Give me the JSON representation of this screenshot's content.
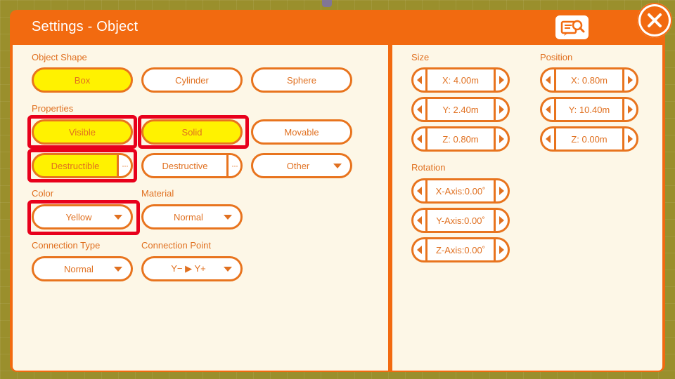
{
  "title": "Settings - Object",
  "help_icon": "document-search-icon",
  "close_icon": "close-icon",
  "object_shape": {
    "label": "Object Shape",
    "options": [
      "Box",
      "Cylinder",
      "Sphere"
    ],
    "selected": "Box"
  },
  "properties": {
    "label": "Properties",
    "visible": "Visible",
    "solid": "Solid",
    "movable": "Movable",
    "destructible": "Destructible",
    "destructive": "Destructive",
    "other": "Other",
    "more": "···"
  },
  "color": {
    "label": "Color",
    "value": "Yellow"
  },
  "material": {
    "label": "Material",
    "value": "Normal"
  },
  "connection_type": {
    "label": "Connection Type",
    "value": "Normal"
  },
  "connection_point": {
    "label": "Connection Point",
    "value": "Y− ▶ Y+"
  },
  "size": {
    "label": "Size",
    "x": "X: 4.00m",
    "y": "Y: 2.40m",
    "z": "Z: 0.80m"
  },
  "position": {
    "label": "Position",
    "x": "X: 0.80m",
    "y": "Y: 10.40m",
    "z": "Z: 0.00m"
  },
  "rotation": {
    "label": "Rotation",
    "x": "X-Axis:0.00˚",
    "y": "Y-Axis:0.00˚",
    "z": "Z-Axis:0.00˚"
  },
  "colors": {
    "accent": "#f26a10",
    "selected": "#fff200",
    "highlight": "#e8001c",
    "panel": "#fdf7e7"
  }
}
